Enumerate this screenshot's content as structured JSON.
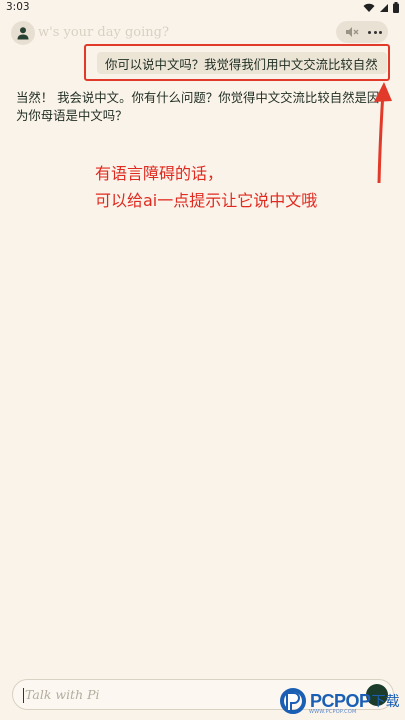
{
  "status_bar": {
    "time": "3:03"
  },
  "header": {
    "title": "w's your day going?"
  },
  "conversation": {
    "user_message": "你可以说中文吗？我觉得我们用中文交流比较自然",
    "ai_message": "当然！ 我会说中文。你有什么问题？你觉得中文交流比较自然是因为你母语是中文吗？"
  },
  "annotation": {
    "line1": "有语言障碍的话，",
    "line2": "可以给ai一点提示让它说中文哦",
    "color": "#e02a20"
  },
  "input": {
    "placeholder": "Talk with Pi"
  },
  "watermark": {
    "brand": "PCPOP",
    "suffix": "下载",
    "sub": "WWW.PCPOP.COM"
  },
  "colors": {
    "background": "#faf3ea",
    "text": "#1f2d22",
    "accent": "#1b3b2b"
  }
}
